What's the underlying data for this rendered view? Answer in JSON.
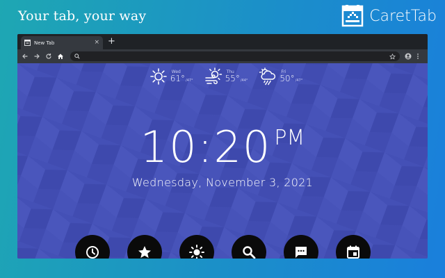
{
  "promo": {
    "tagline": "Your tab, your way",
    "brand_name": "CaretTab"
  },
  "browser": {
    "tab_title": "New Tab",
    "tab_close": "×",
    "new_tab": "+",
    "omnibox": {
      "value": "",
      "placeholder": ""
    }
  },
  "weather": [
    {
      "day": "Wed",
      "high": "61°",
      "low": "/47°",
      "condition": "sunny"
    },
    {
      "day": "Thu",
      "high": "55°",
      "low": "/44°",
      "condition": "windy-partly-sunny"
    },
    {
      "day": "Fri",
      "high": "50°",
      "low": "/47°",
      "condition": "rain"
    }
  ],
  "clock": {
    "time": "10:20",
    "ampm": "PM",
    "date": "Wednesday, November 3, 2021"
  },
  "dock": [
    {
      "name": "clock-button",
      "icon": "clock-icon"
    },
    {
      "name": "bookmarks-button",
      "icon": "star-icon"
    },
    {
      "name": "weather-button",
      "icon": "sun-icon"
    },
    {
      "name": "search-button",
      "icon": "search-icon"
    },
    {
      "name": "notes-button",
      "icon": "chat-icon"
    },
    {
      "name": "calendar-button",
      "icon": "calendar-icon"
    }
  ],
  "colors": {
    "page_background": "#4450b6",
    "chrome_dark": "#1f2226",
    "dock_button": "#0a0a0a"
  }
}
